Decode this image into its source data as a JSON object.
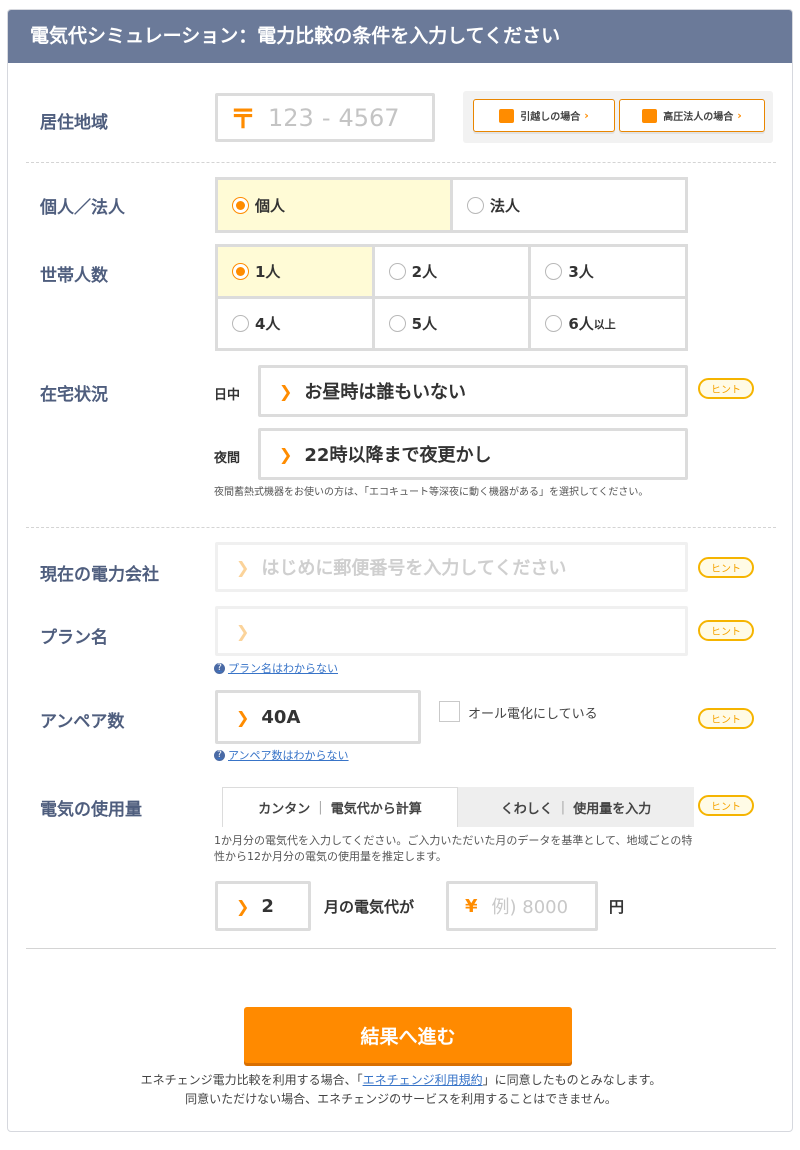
{
  "header": {
    "title": "電気代シミュレーション：電力比較の条件を入力してください"
  },
  "region": {
    "label": "居住地域",
    "zip_mark": "〒",
    "zip1_placeholder": "123",
    "zip_sep": "-",
    "zip2_placeholder": "4567",
    "moving_button": "引越しの場合",
    "highvoltage_button": "高圧法人の場合"
  },
  "entity": {
    "label": "個人／法人",
    "options": [
      {
        "label": "個人",
        "selected": true
      },
      {
        "label": "法人",
        "selected": false
      }
    ]
  },
  "household": {
    "label": "世帯人数",
    "options": [
      "1人",
      "2人",
      "3人",
      "4人",
      "5人",
      "6人"
    ],
    "last_suffix": "以上",
    "selected": "1人"
  },
  "presence": {
    "label": "在宅状況",
    "day_label": "日中",
    "day_value": "お昼時は誰もいない",
    "night_label": "夜間",
    "night_value": "22時以降まで夜更かし",
    "note": "夜間蓄熱式機器をお使いの方は、「エコキュート等深夜に動く機器がある」を選択してください。"
  },
  "hint_label": "ヒント",
  "company": {
    "label": "現在の電力会社",
    "value": "はじめに郵便番号を入力してください"
  },
  "plan": {
    "label": "プラン名",
    "value": "",
    "help": "プラン名はわからない"
  },
  "ampere": {
    "label": "アンペア数",
    "value": "40A",
    "all_electric": "オール電化にしている",
    "help": "アンペア数はわからない"
  },
  "usage": {
    "label": "電気の使用量",
    "tab1_a": "カンタン",
    "tab1_b": "電気代から計算",
    "tab2_a": "くわしく",
    "tab2_b": "使用量を入力",
    "tab_sep": "|",
    "desc": "1か月分の電気代を入力してください。ご入力いただいた月のデータを基準として、地域ごとの特性から12か月分の電気の使用量を推定します。",
    "month": "2",
    "month_text": "月の電気代が",
    "yen_mark": "¥",
    "amount_placeholder": "例) 8000",
    "unit": "円"
  },
  "submit": {
    "label": "結果へ進む"
  },
  "terms": {
    "line1_pre": "エネチェンジ電力比較を利用する場合、「",
    "line1_link": "エネチェンジ利用規約",
    "line1_post": "」に同意したものとみなします。",
    "line2": "同意いただけない場合、エネチェンジのサービスを利用することはできません。"
  },
  "colors": {
    "accent": "#ff8a00",
    "header": "#6b7a99",
    "label": "#4f5e7e",
    "link": "#3874c8"
  }
}
